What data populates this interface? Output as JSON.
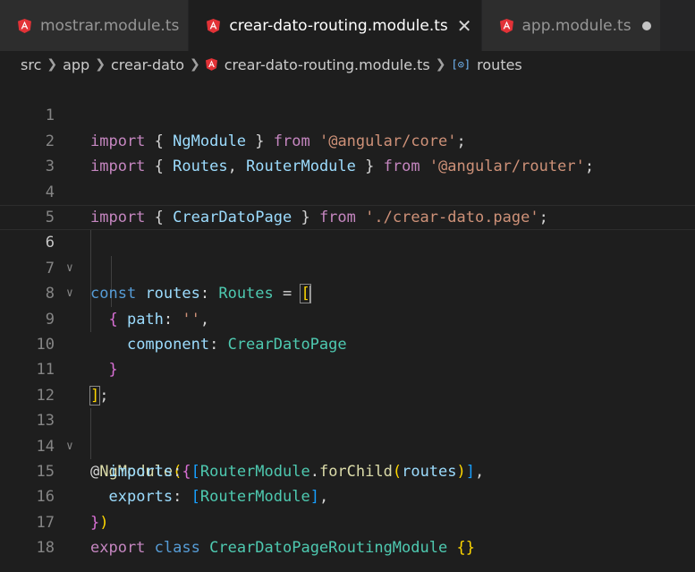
{
  "tabs": [
    {
      "label": "mostrar.module.ts",
      "active": false,
      "icon": "angular-icon"
    },
    {
      "label": "crear-dato-routing.module.ts",
      "active": true,
      "icon": "angular-icon",
      "close_glyph": "✕"
    },
    {
      "label": "app.module.ts",
      "active": false,
      "icon": "angular-icon",
      "dirty": true
    }
  ],
  "breadcrumb": {
    "items": [
      "src",
      "app",
      "crear-dato",
      "crear-dato-routing.module.ts",
      "routes"
    ],
    "symbol_icon_glyph": "[⊙]"
  },
  "editor": {
    "line_numbers": [
      "1",
      "2",
      "3",
      "4",
      "5",
      "6",
      "7",
      "8",
      "9",
      "10",
      "11",
      "12",
      "13",
      "14",
      "15",
      "16",
      "17",
      "18"
    ],
    "current_line": 6,
    "fold_lines": [
      6,
      7,
      13
    ],
    "lines": [
      "import { NgModule } from '@angular/core';",
      "import { Routes, RouterModule } from '@angular/router';",
      "",
      "import { CrearDatoPage } from './crear-dato.page';",
      "",
      "const routes: Routes = [",
      "  {",
      "    path: '',",
      "    component: CrearDatoPage",
      "  }",
      "];",
      "",
      "@NgModule({",
      "  imports: [RouterModule.forChild(routes)],",
      "  exports: [RouterModule],",
      "})",
      "export class CrearDatoPageRoutingModule {}",
      ""
    ]
  },
  "colors": {
    "background": "#1e1e1e",
    "tab_inactive": "#2d2d2d",
    "angular_red": "#e23237",
    "keyword": "#569cd6",
    "control": "#c586c0",
    "type": "#4ec9b0",
    "variable": "#9cdcfe",
    "string": "#ce9178",
    "function": "#dcdcaa"
  }
}
